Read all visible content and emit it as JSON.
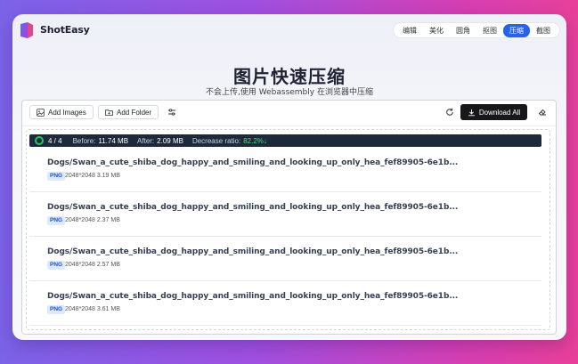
{
  "app": {
    "brand": "ShotEasy"
  },
  "nav": {
    "items": [
      {
        "label": "编辑",
        "active": false
      },
      {
        "label": "美化",
        "active": false
      },
      {
        "label": "圆角",
        "active": false
      },
      {
        "label": "抠图",
        "active": false
      },
      {
        "label": "压缩",
        "active": true
      },
      {
        "label": "截图",
        "active": false
      }
    ]
  },
  "hero": {
    "title": "图片快速压缩",
    "subtitle": "不会上传,使用 Webassembly 在浏览器中压缩"
  },
  "toolbar": {
    "add_images": "Add Images",
    "add_folder": "Add Folder",
    "download_all": "Download All"
  },
  "status": {
    "count": "4 / 4",
    "before_label": "Before:",
    "before_value": "11.74 MB",
    "after_label": "After:",
    "after_value": "2.09 MB",
    "ratio_label": "Decrease ratio:",
    "ratio_value": "82.2%↓"
  },
  "files": [
    {
      "name": "Dogs/Swan_a_cute_shiba_dog_happy_and_smiling_and_looking_up_only_hea_fef89905-6e1b...",
      "type": "PNG",
      "meta": "2048*2048 3.19 MB"
    },
    {
      "name": "Dogs/Swan_a_cute_shiba_dog_happy_and_smiling_and_looking_up_only_hea_fef89905-6e1b...",
      "type": "PNG",
      "meta": "2048*2048 2.37 MB"
    },
    {
      "name": "Dogs/Swan_a_cute_shiba_dog_happy_and_smiling_and_looking_up_only_hea_fef89905-6e1b...",
      "type": "PNG",
      "meta": "2048*2048 2.57 MB"
    },
    {
      "name": "Dogs/Swan_a_cute_shiba_dog_happy_and_smiling_and_looking_up_only_hea_fef89905-6e1b...",
      "type": "PNG",
      "meta": "2048*2048 3.61 MB"
    }
  ]
}
